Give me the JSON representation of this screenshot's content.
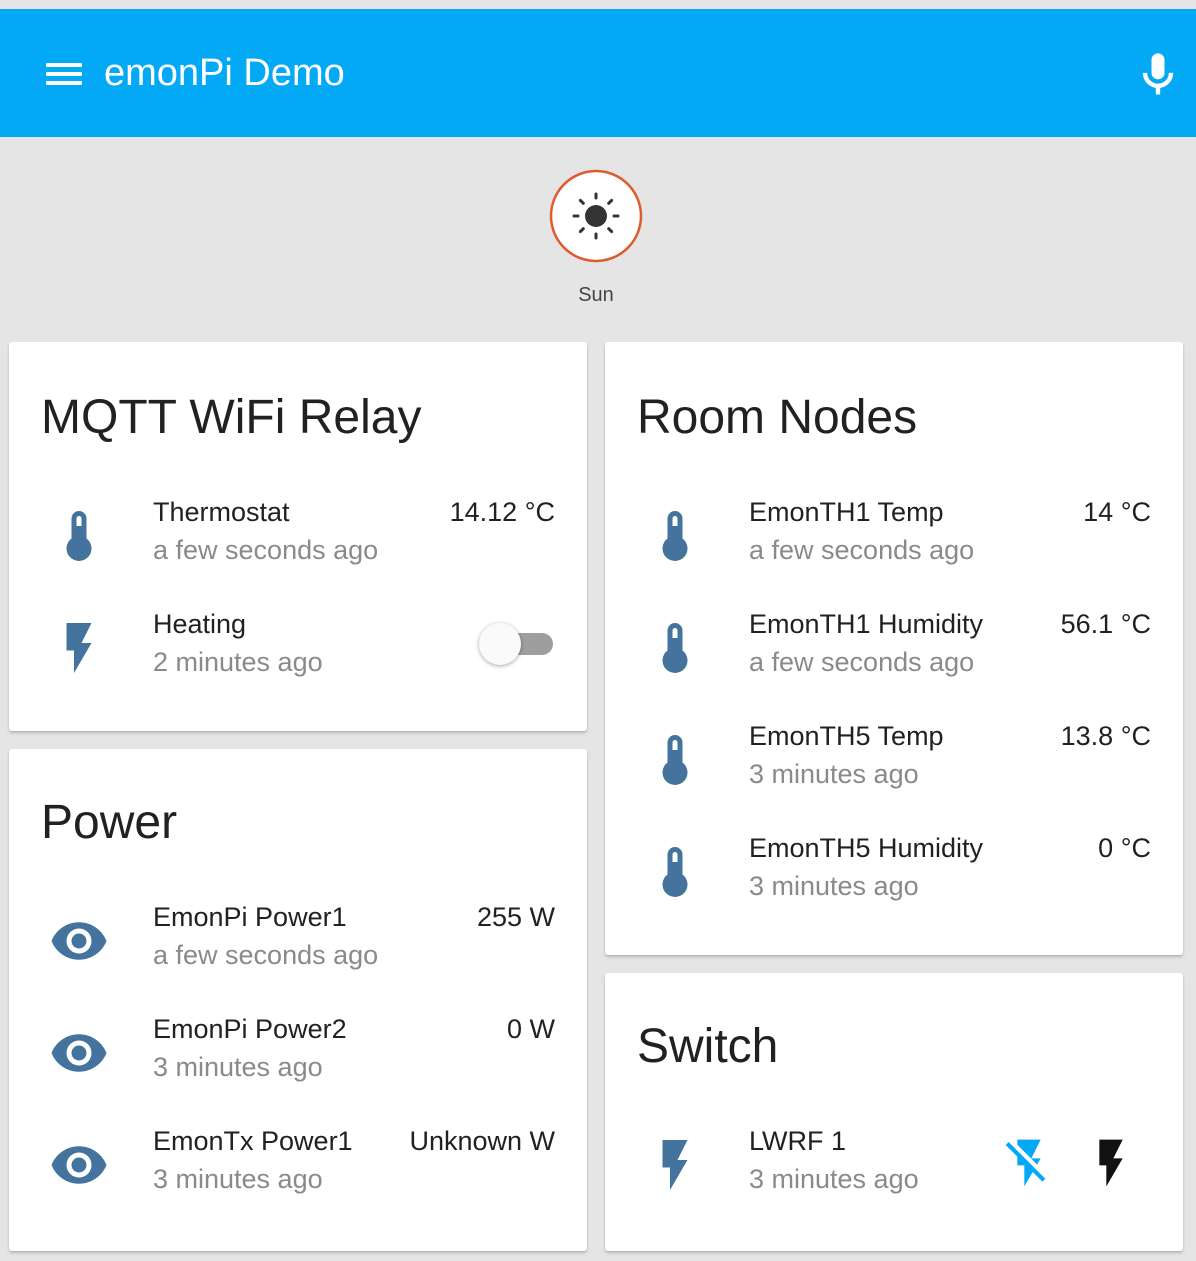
{
  "app": {
    "title": "emonPi Demo"
  },
  "colors": {
    "header": "#03a9f4",
    "icon": "#44739e",
    "active": "#03a9f4",
    "sun_ring": "#e05a2b"
  },
  "badges": [
    {
      "label": "Sun",
      "icon": "sun-icon"
    }
  ],
  "cards": {
    "relay": {
      "title": "MQTT WiFi Relay",
      "rows": [
        {
          "name": "Thermostat",
          "time": "a few seconds ago",
          "value": "14.12 °C",
          "icon": "thermometer-icon"
        },
        {
          "name": "Heating",
          "time": "2 minutes ago",
          "icon": "flash-icon",
          "toggle_on": false
        }
      ]
    },
    "power": {
      "title": "Power",
      "rows": [
        {
          "name": "EmonPi Power1",
          "time": "a few seconds ago",
          "value": "255 W",
          "icon": "eye-icon"
        },
        {
          "name": "EmonPi Power2",
          "time": "3 minutes ago",
          "value": "0 W",
          "icon": "eye-icon"
        },
        {
          "name": "EmonTx Power1",
          "time": "3 minutes ago",
          "value": "Unknown W",
          "icon": "eye-icon"
        }
      ]
    },
    "rooms": {
      "title": "Room Nodes",
      "rows": [
        {
          "name": "EmonTH1 Temp",
          "time": "a few seconds ago",
          "value": "14 °C",
          "icon": "thermometer-icon"
        },
        {
          "name": "EmonTH1 Humidity",
          "time": "a few seconds ago",
          "value": "56.1 °C",
          "icon": "thermometer-icon"
        },
        {
          "name": "EmonTH5 Temp",
          "time": "3 minutes ago",
          "value": "13.8 °C",
          "icon": "thermometer-icon"
        },
        {
          "name": "EmonTH5 Humidity",
          "time": "3 minutes ago",
          "value": "0 °C",
          "icon": "thermometer-icon"
        }
      ]
    },
    "switch": {
      "title": "Switch",
      "rows": [
        {
          "name": "LWRF 1",
          "time": "3 minutes ago",
          "icon": "flash-icon",
          "off_icon": "flash-off-icon",
          "on_icon": "flash-icon"
        }
      ]
    }
  }
}
